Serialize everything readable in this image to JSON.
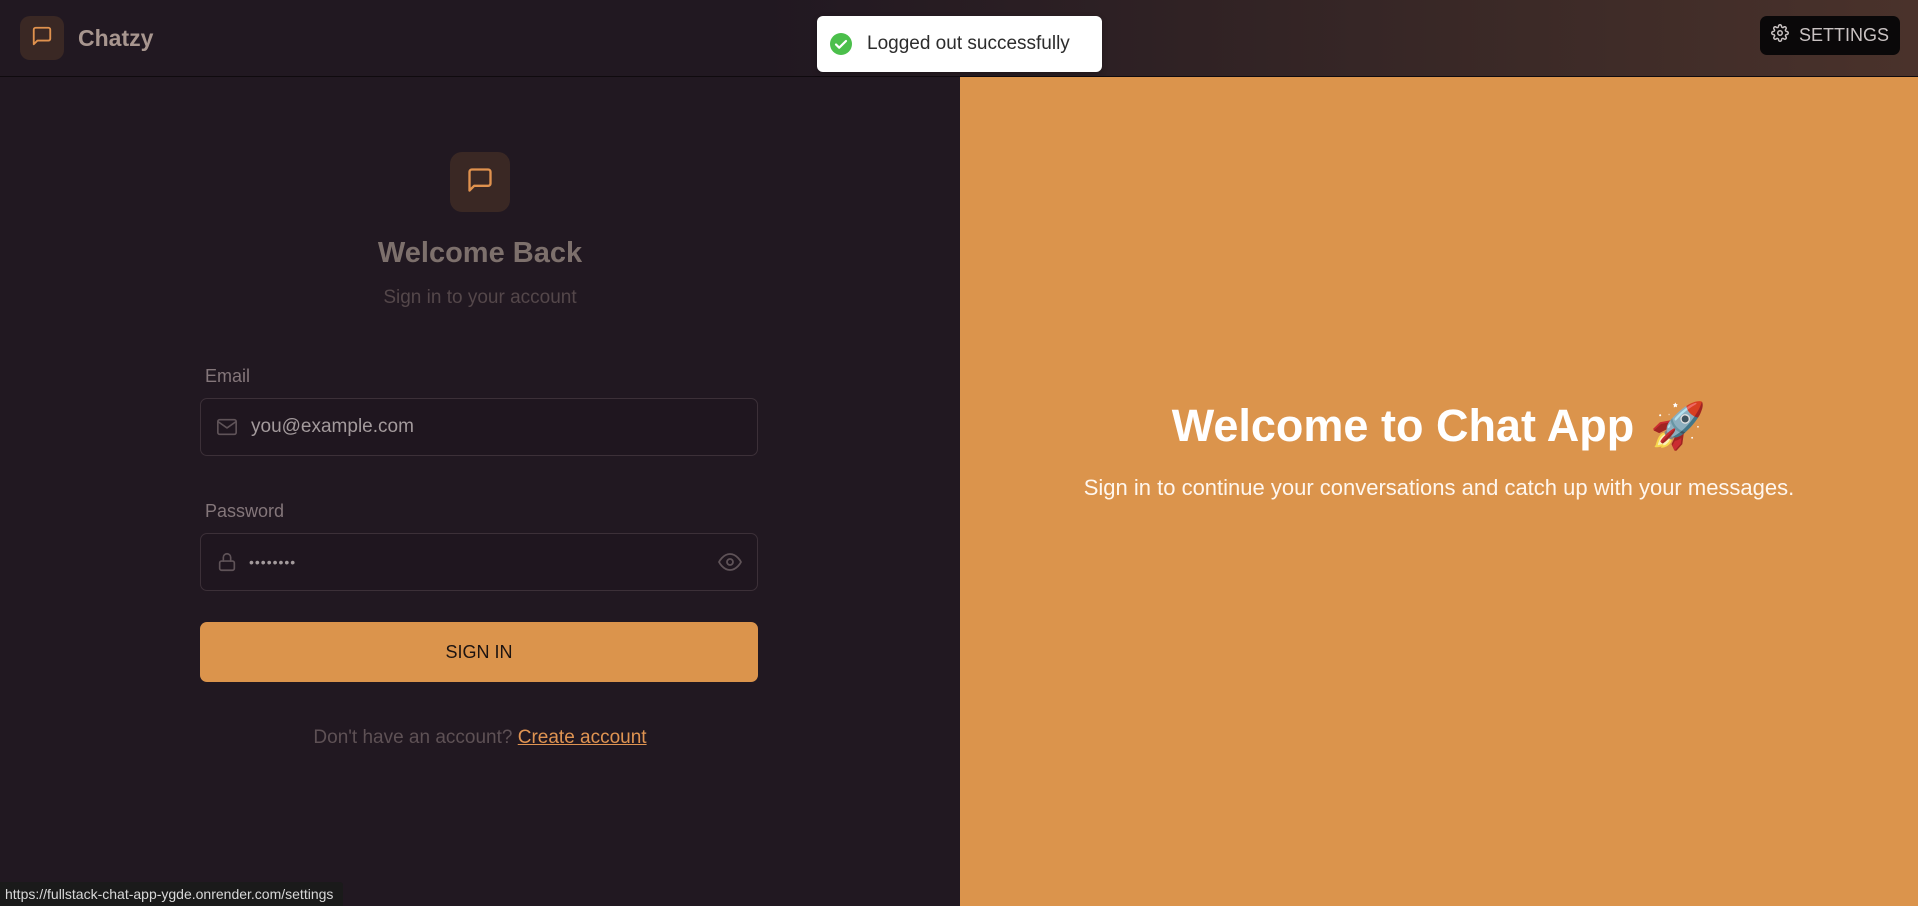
{
  "navbar": {
    "brand": "Chatzy",
    "settings_label": "SETTINGS"
  },
  "toast": {
    "message": "Logged out successfully",
    "status_color": "#4bbf4b"
  },
  "login": {
    "title": "Welcome Back",
    "subtitle": "Sign in to your account",
    "email_label": "Email",
    "email_placeholder": "you@example.com",
    "password_label": "Password",
    "password_masked": "••••••••",
    "signin_label": "SIGN IN",
    "no_account_text": "Don't have an account?",
    "create_account_link": "Create account"
  },
  "hero": {
    "title": "Welcome to Chat App",
    "emoji": "🚀",
    "subtitle": "Sign in to continue your conversations and catch up with your messages."
  },
  "status_bar": {
    "url": "https://fullstack-chat-app-ygde.onrender.com/settings"
  },
  "colors": {
    "accent": "#db944c",
    "background": "#211821"
  },
  "icons": {
    "brand": "message-square-icon",
    "settings": "gear-icon",
    "toast": "check-circle-icon",
    "email": "mail-icon",
    "password": "lock-icon",
    "toggle": "eye-icon"
  }
}
